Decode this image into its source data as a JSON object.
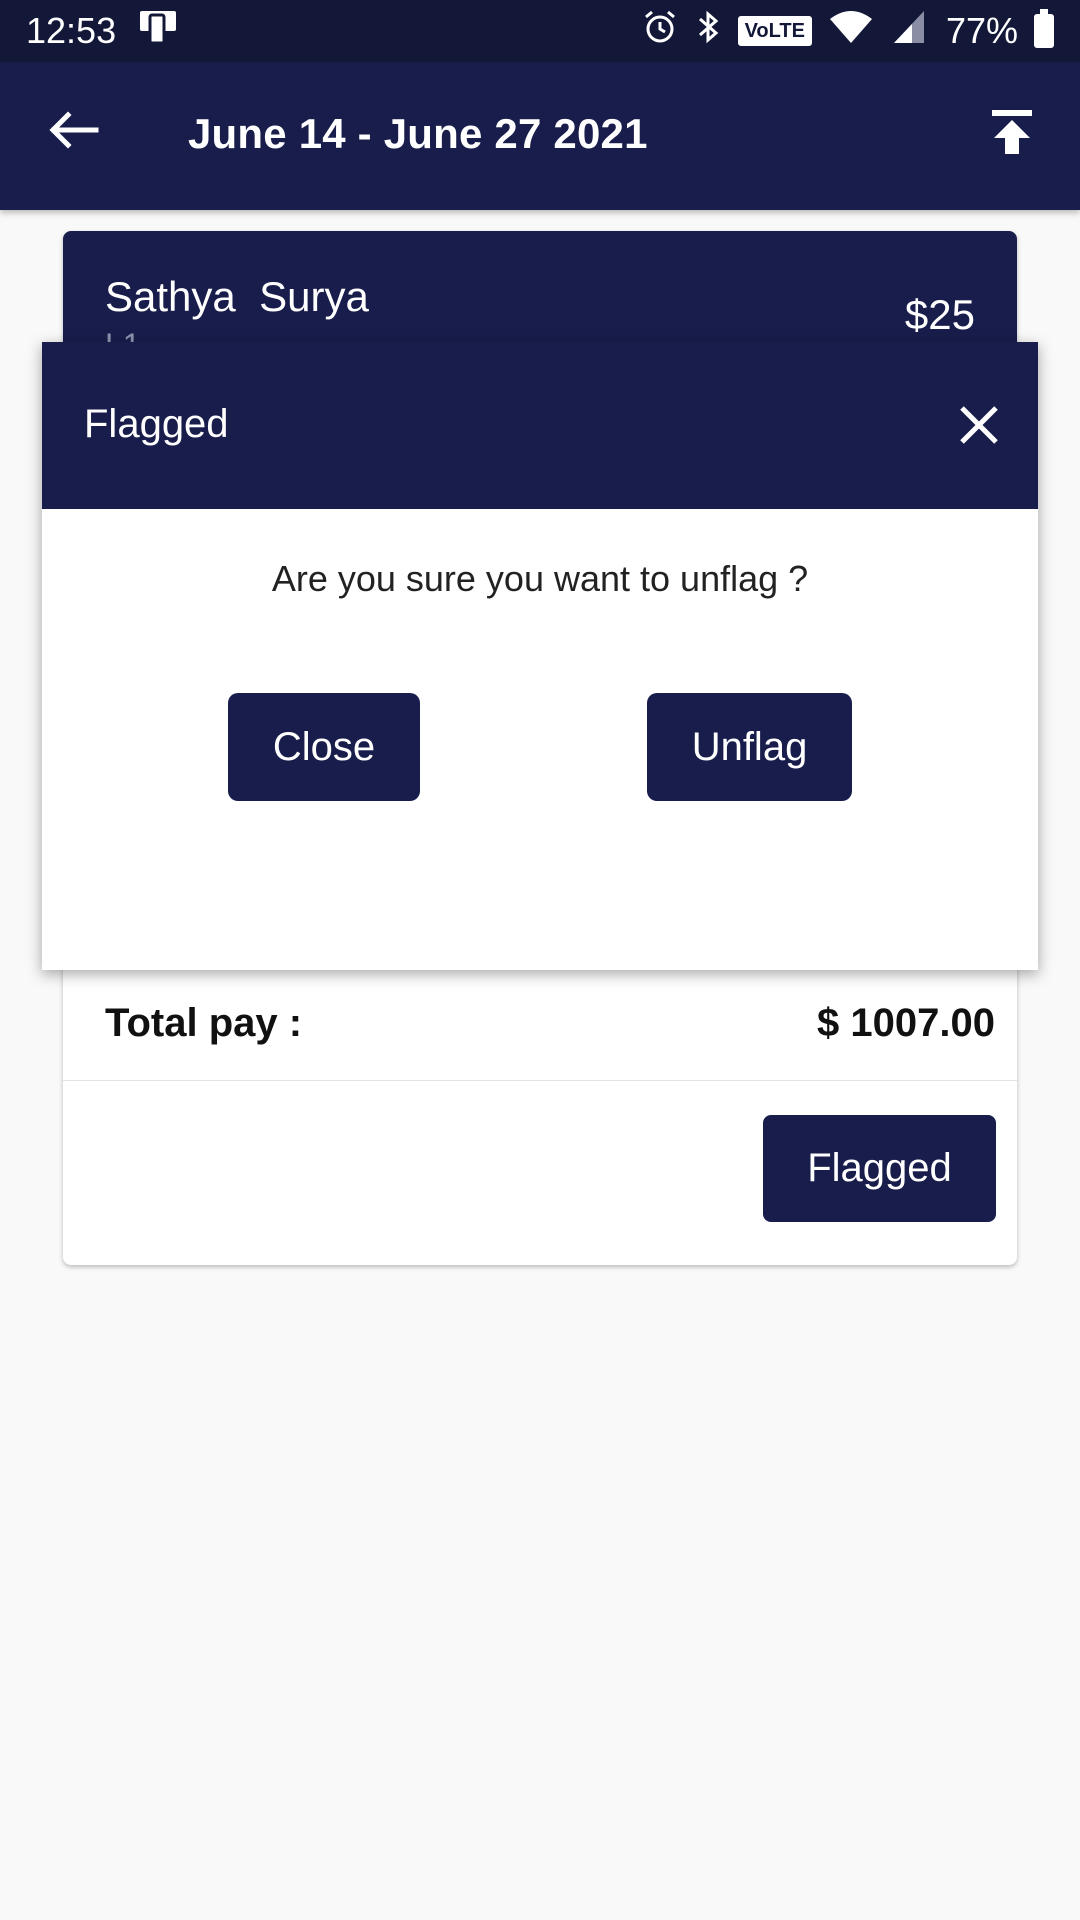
{
  "status_bar": {
    "time": "12:53",
    "volte": "VoLTE",
    "battery": "77%",
    "icons": [
      "device-icon",
      "alarm-icon",
      "bluetooth-icon",
      "wifi-icon",
      "signal-icon",
      "battery-icon"
    ]
  },
  "app_bar": {
    "title": "June 14 - June 27 2021",
    "back_icon": "arrow-left-icon",
    "upload_icon": "upload-icon"
  },
  "card": {
    "name": "Sathya  Surya",
    "sub": "L1",
    "amount": "$25",
    "total_label": "Total pay :",
    "total_value": "$ 1007.00",
    "flagged_button": "Flagged"
  },
  "dialog": {
    "title": "Flagged",
    "message": "Are you sure you want to unflag ?",
    "close_button": "Close",
    "unflag_button": "Unflag"
  },
  "colors": {
    "primary": "#181d4b",
    "status_bar": "#131838",
    "background": "#f9f9f9"
  }
}
